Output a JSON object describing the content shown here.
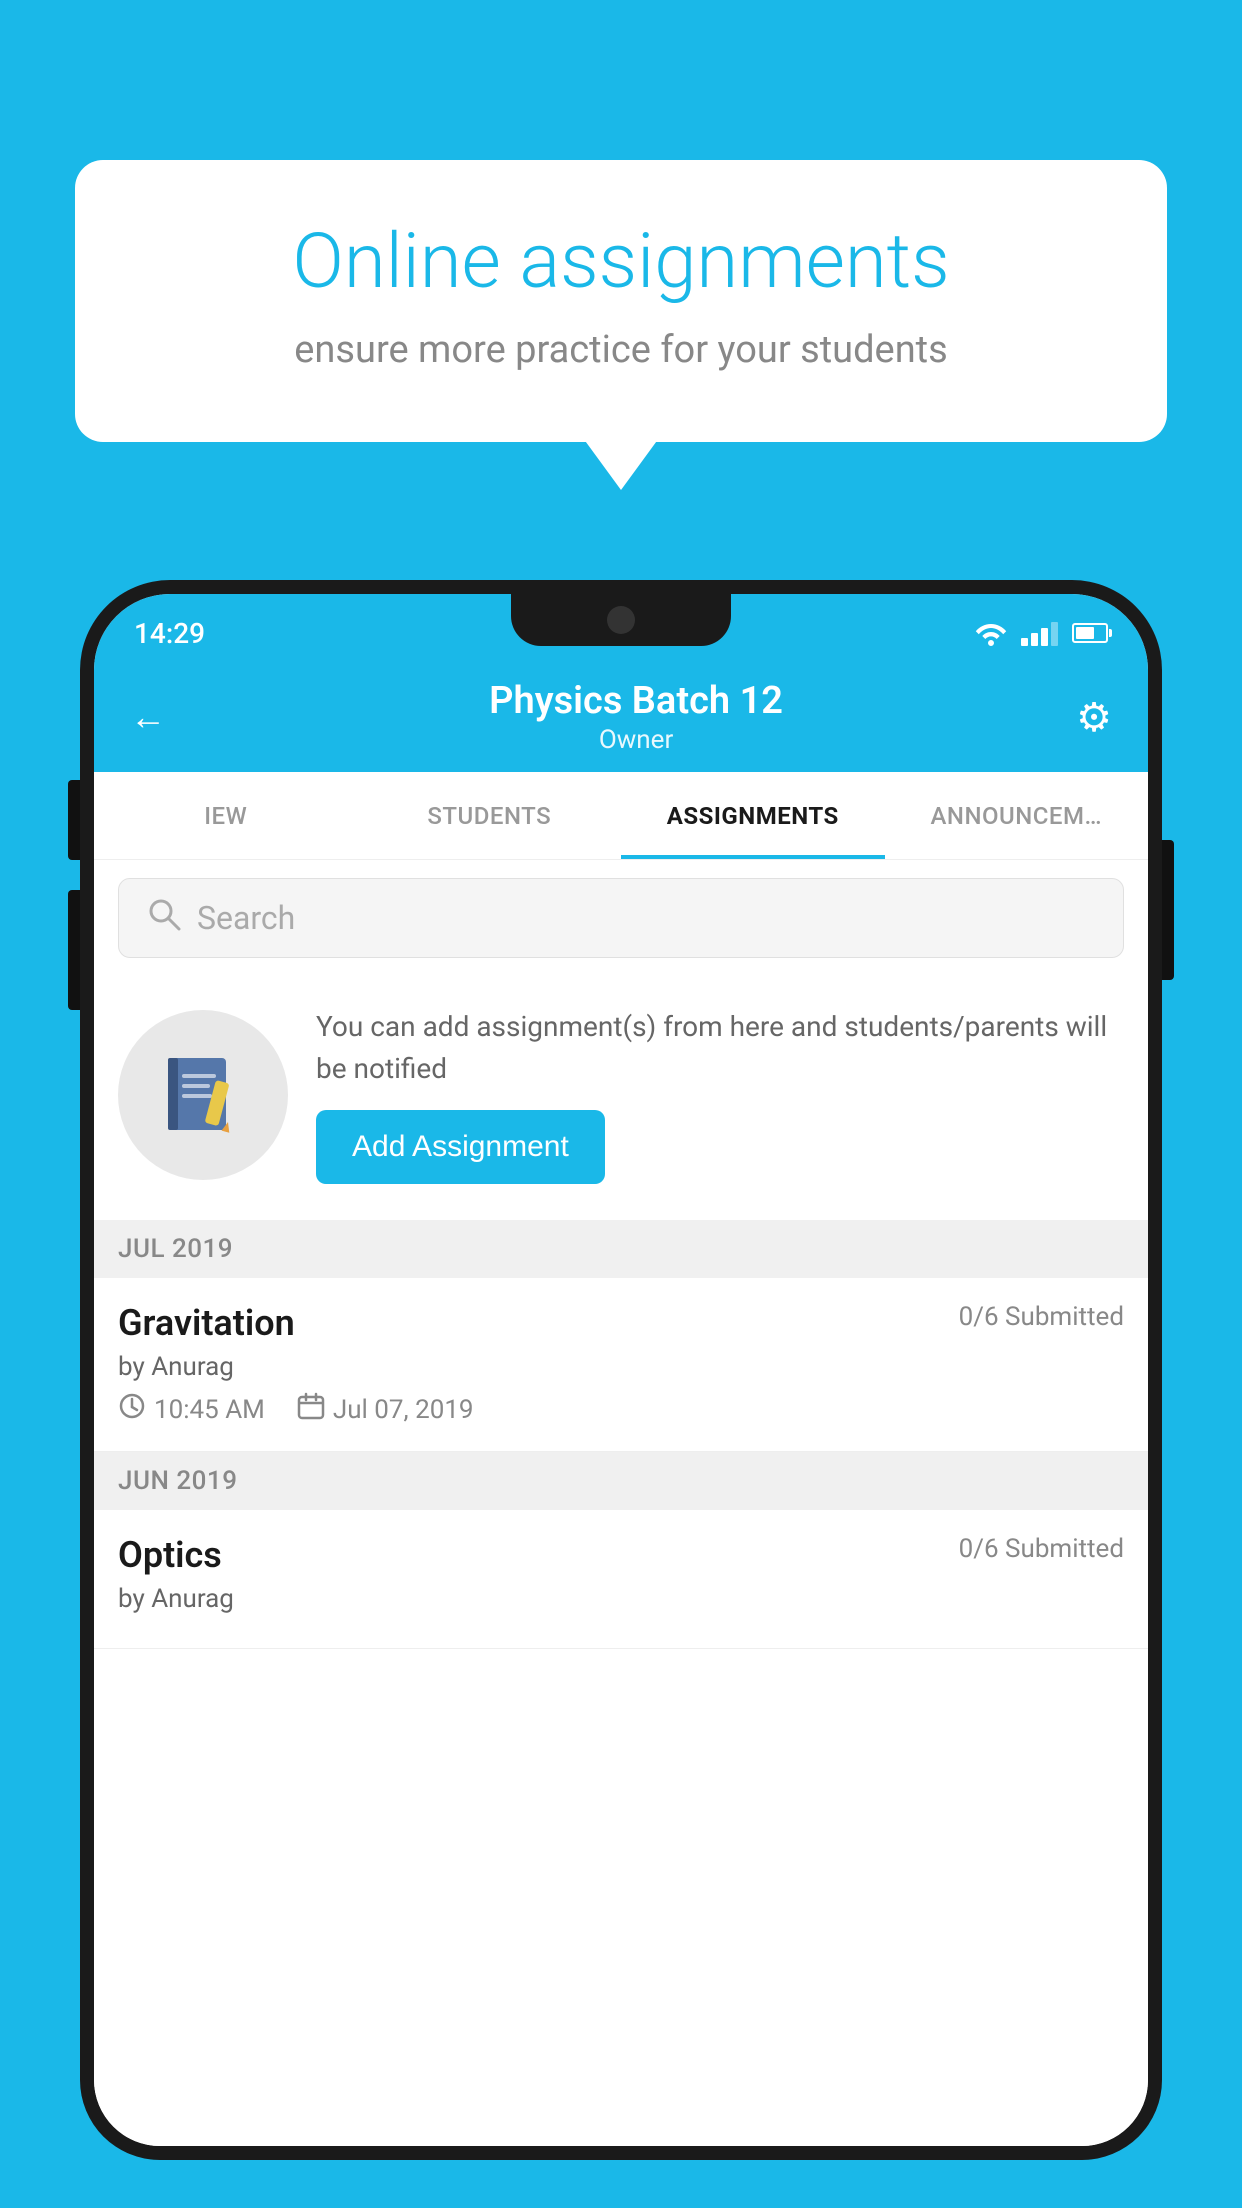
{
  "background_color": "#1ab8e8",
  "speech_bubble": {
    "title": "Online assignments",
    "subtitle": "ensure more practice for your students"
  },
  "status_bar": {
    "time": "14:29",
    "wifi": "▾",
    "battery_level": 65
  },
  "app_header": {
    "title": "Physics Batch 12",
    "subtitle": "Owner",
    "back_label": "←",
    "settings_label": "⚙"
  },
  "tabs": [
    {
      "id": "iew",
      "label": "IEW",
      "active": false
    },
    {
      "id": "students",
      "label": "STUDENTS",
      "active": false
    },
    {
      "id": "assignments",
      "label": "ASSIGNMENTS",
      "active": true
    },
    {
      "id": "announcements",
      "label": "ANNOUNCEM…",
      "active": false
    }
  ],
  "search": {
    "placeholder": "Search"
  },
  "promo_card": {
    "icon": "📓",
    "text": "You can add assignment(s) from here and students/parents will be notified",
    "button_label": "Add Assignment"
  },
  "sections": [
    {
      "header": "JUL 2019",
      "assignments": [
        {
          "title": "Gravitation",
          "submitted": "0/6 Submitted",
          "author": "by Anurag",
          "time": "10:45 AM",
          "date": "Jul 07, 2019"
        }
      ]
    },
    {
      "header": "JUN 2019",
      "assignments": [
        {
          "title": "Optics",
          "submitted": "0/6 Submitted",
          "author": "by Anurag",
          "time": "",
          "date": ""
        }
      ]
    }
  ]
}
